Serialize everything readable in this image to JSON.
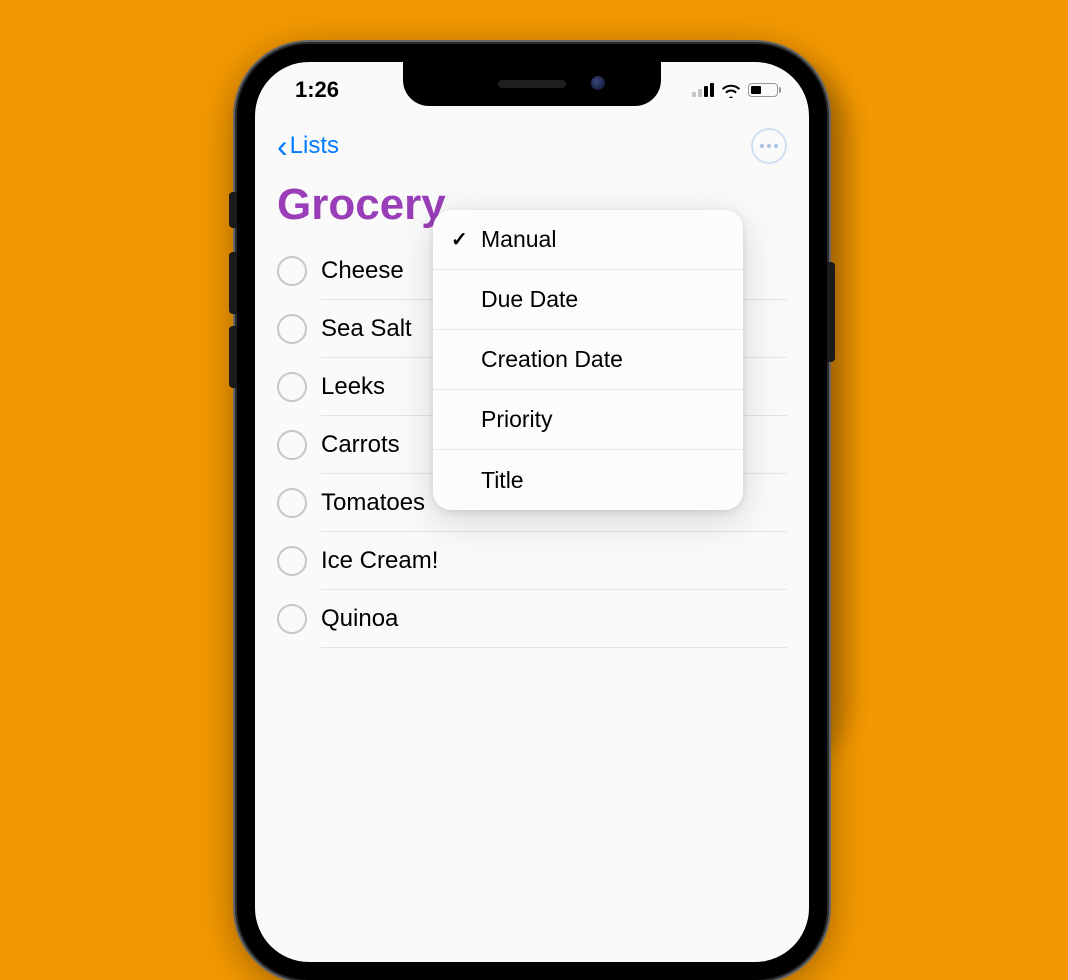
{
  "statusbar": {
    "time": "1:26"
  },
  "navbar": {
    "back_label": "Lists"
  },
  "list": {
    "title": "Grocery",
    "items": [
      {
        "label": "Cheese"
      },
      {
        "label": "Sea Salt"
      },
      {
        "label": "Leeks"
      },
      {
        "label": "Carrots"
      },
      {
        "label": "Tomatoes"
      },
      {
        "label": "Ice Cream!"
      },
      {
        "label": "Quinoa"
      }
    ]
  },
  "sort_menu": {
    "options": [
      {
        "label": "Manual",
        "selected": true
      },
      {
        "label": "Due Date",
        "selected": false
      },
      {
        "label": "Creation Date",
        "selected": false
      },
      {
        "label": "Priority",
        "selected": false
      },
      {
        "label": "Title",
        "selected": false
      }
    ]
  },
  "colors": {
    "accent": "#007aff",
    "title": "#9a3db8",
    "background": "#f39800"
  }
}
